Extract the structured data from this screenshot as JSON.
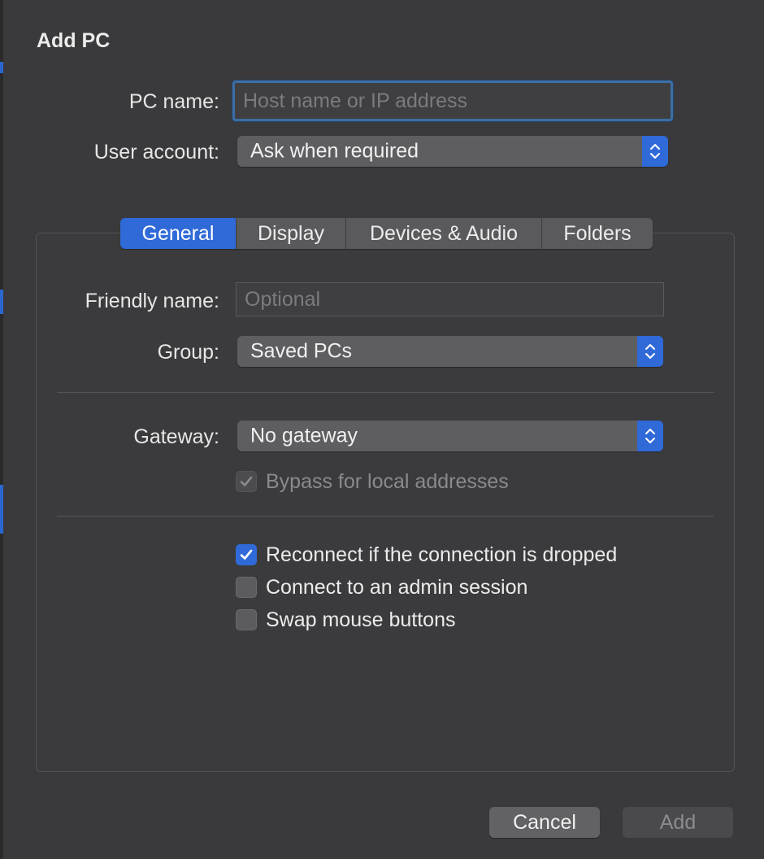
{
  "dialog": {
    "title": "Add PC"
  },
  "pc_name": {
    "label": "PC name:",
    "value": "",
    "placeholder": "Host name or IP address"
  },
  "user_account": {
    "label": "User account:",
    "selected": "Ask when required"
  },
  "tabs": [
    {
      "label": "General",
      "active": true
    },
    {
      "label": "Display",
      "active": false
    },
    {
      "label": "Devices & Audio",
      "active": false
    },
    {
      "label": "Folders",
      "active": false
    }
  ],
  "general": {
    "friendly_name": {
      "label": "Friendly name:",
      "value": "",
      "placeholder": "Optional"
    },
    "group": {
      "label": "Group:",
      "selected": "Saved PCs"
    },
    "gateway": {
      "label": "Gateway:",
      "selected": "No gateway"
    },
    "bypass_local": {
      "label": "Bypass for local addresses",
      "checked": true,
      "enabled": false
    },
    "reconnect": {
      "label": "Reconnect if the connection is dropped",
      "checked": true
    },
    "admin_session": {
      "label": "Connect to an admin session",
      "checked": false
    },
    "swap_mouse": {
      "label": "Swap mouse buttons",
      "checked": false
    }
  },
  "buttons": {
    "cancel": "Cancel",
    "add": "Add"
  },
  "colors": {
    "accent": "#2f6ad8",
    "background": "#3a3a3c",
    "focus_ring": "#3d6ea3"
  },
  "icons": {
    "select_stepper": "chevron-up-down-icon",
    "checkmark": "checkmark-icon"
  }
}
